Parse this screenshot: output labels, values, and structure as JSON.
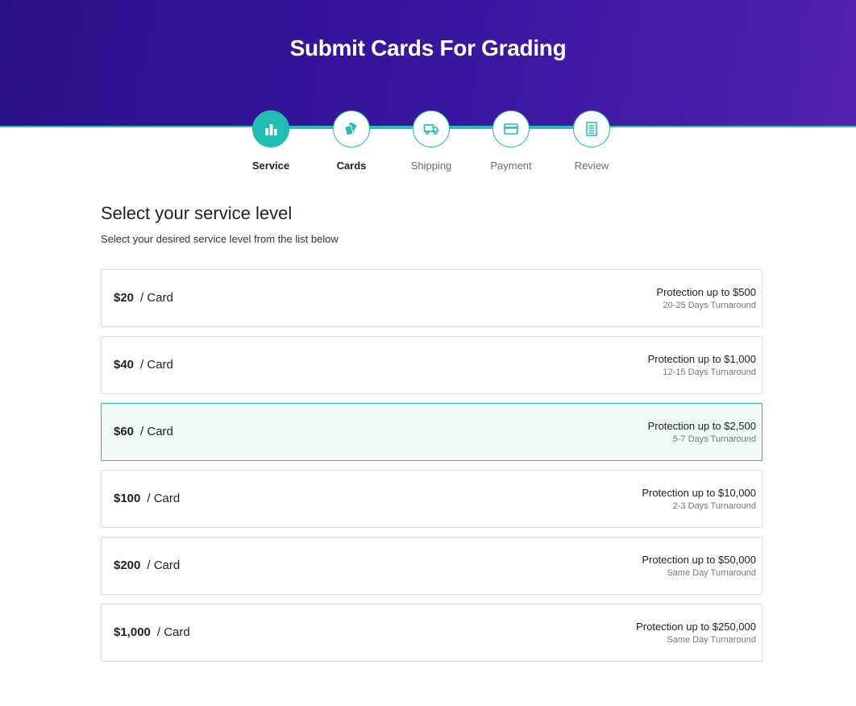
{
  "header": {
    "title": "Submit Cards For Grading"
  },
  "steps": [
    {
      "label": "Service",
      "icon": "bar-chart-icon",
      "state": "active"
    },
    {
      "label": "Cards",
      "icon": "cards-icon",
      "state": "next"
    },
    {
      "label": "Shipping",
      "icon": "truck-icon",
      "state": "upcoming"
    },
    {
      "label": "Payment",
      "icon": "credit-card-icon",
      "state": "upcoming"
    },
    {
      "label": "Review",
      "icon": "receipt-icon",
      "state": "upcoming"
    }
  ],
  "section": {
    "title": "Select your service level",
    "subtitle": "Select your desired service level from the list below"
  },
  "per_card_label": "/ Card",
  "service_levels": [
    {
      "price": "$20",
      "protection": "Protection up to $500",
      "turnaround": "20-25 Days Turnaround",
      "selected": false
    },
    {
      "price": "$40",
      "protection": "Protection up to $1,000",
      "turnaround": "12-15 Days Turnaround",
      "selected": false
    },
    {
      "price": "$60",
      "protection": "Protection up to $2,500",
      "turnaround": "5-7 Days Turnaround",
      "selected": true
    },
    {
      "price": "$100",
      "protection": "Protection up to $10,000",
      "turnaround": "2-3 Days Turnaround",
      "selected": false
    },
    {
      "price": "$200",
      "protection": "Protection up to $50,000",
      "turnaround": "Same Day Turnaround",
      "selected": false
    },
    {
      "price": "$1,000",
      "protection": "Protection up to $250,000",
      "turnaround": "Same Day Turnaround",
      "selected": false
    }
  ],
  "colors": {
    "accent": "#20bdb3",
    "header_start": "#2a0f8a",
    "header_end": "#5122ae",
    "selected_bg": "#f1faf8"
  }
}
